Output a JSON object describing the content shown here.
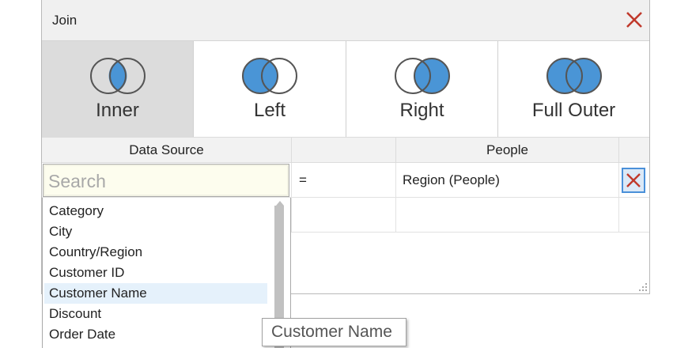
{
  "dialog": {
    "title": "Join",
    "join_types": [
      {
        "label": "Inner",
        "icon": "venn-inner-icon",
        "selected": true
      },
      {
        "label": "Left",
        "icon": "venn-left-icon",
        "selected": false
      },
      {
        "label": "Right",
        "icon": "venn-right-icon",
        "selected": false
      },
      {
        "label": "Full Outer",
        "icon": "venn-full-outer-icon",
        "selected": false
      }
    ],
    "columns": {
      "left": "Data Source",
      "right": "People"
    },
    "clause": {
      "operator": "=",
      "right_field": "Region (People)"
    },
    "colors": {
      "accent": "#4a90d9",
      "venn_fill": "#4a95d6",
      "close": "#c0392b"
    }
  },
  "search": {
    "placeholder": "Search",
    "value": ""
  },
  "field_list": [
    "Category",
    "City",
    "Country/Region",
    "Customer ID",
    "Customer Name",
    "Discount",
    "Order Date"
  ],
  "hovered_field": "Customer Name",
  "tooltip": "Customer Name"
}
